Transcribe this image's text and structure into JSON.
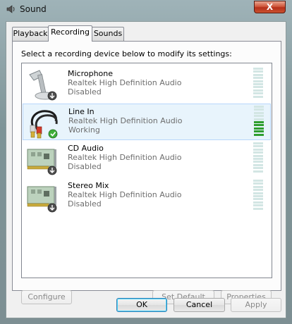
{
  "window": {
    "title": "Sound",
    "close_label": "X"
  },
  "tabs": [
    {
      "label": "Playback"
    },
    {
      "label": "Recording"
    },
    {
      "label": "Sounds"
    }
  ],
  "instruction": "Select a recording device below to modify its settings:",
  "devices": [
    {
      "name": "Microphone",
      "driver": "Realtek High Definition Audio",
      "status": "Disabled",
      "icon": "microphone-icon",
      "badge": "disabled-arrow",
      "level": 0
    },
    {
      "name": "Line In",
      "driver": "Realtek High Definition Audio",
      "status": "Working",
      "icon": "line-in-cable-icon",
      "badge": "default-check",
      "level": 0.5
    },
    {
      "name": "CD Audio",
      "driver": "Realtek High Definition Audio",
      "status": "Disabled",
      "icon": "sound-card-icon",
      "badge": "disabled-arrow",
      "level": 0
    },
    {
      "name": "Stereo Mix",
      "driver": "Realtek High Definition Audio",
      "status": "Disabled",
      "icon": "sound-card-icon",
      "badge": "disabled-arrow",
      "level": 0
    }
  ],
  "panel_buttons": {
    "configure": "Configure",
    "set_default": "Set Default",
    "properties": "Properties"
  },
  "dialog_buttons": {
    "ok": "OK",
    "cancel": "Cancel",
    "apply": "Apply"
  },
  "colors": {
    "meter_active": "#2f9e2f",
    "meter_idle": "#d3e6e4",
    "selection": "#e8f4fc"
  }
}
